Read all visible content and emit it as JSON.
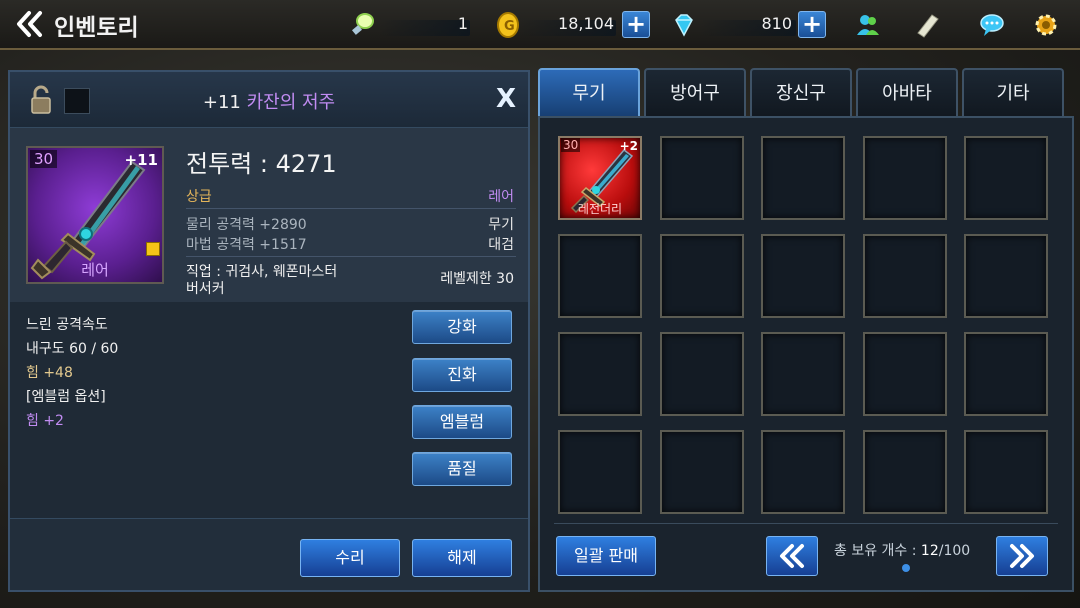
{
  "header": {
    "title": "인벤토리",
    "energy_value": "1",
    "gold_value": "18,104",
    "gem_value": "810",
    "plus_label": "+"
  },
  "item": {
    "enhance": "+11",
    "name": "카잔의 저주",
    "close_label": "X",
    "level": "30",
    "plus": "+11",
    "grade": "레어",
    "power_label": "전투력 : 4271",
    "quality": "상급",
    "rarity": "레어",
    "phys_attack": "물리 공격력 +2890",
    "magic_attack": "마법 공격력 +1517",
    "category": "무기",
    "weapon_type": "대검",
    "job_line1": "직업 : 귀검사, 웨폰마스터",
    "job_line2": "버서커",
    "level_limit": "레벨제한 30",
    "details": [
      "느린 공격속도",
      "내구도 60 / 60",
      "힘 +48",
      "[엠블럼 옵션]",
      "힘 +2"
    ]
  },
  "actions": {
    "reinforce": "강화",
    "evolve": "진화",
    "emblem": "엠블럼",
    "quality": "품질",
    "repair": "수리",
    "unequip": "해제"
  },
  "tabs": [
    "무기",
    "방어구",
    "장신구",
    "아바타",
    "기타"
  ],
  "grid": {
    "slot1_level": "30",
    "slot1_plus": "+2",
    "slot1_grade": "레전더리"
  },
  "footer": {
    "sell_all": "일괄 판매",
    "count_label": "총 보유 개수 : ",
    "count_current": "12",
    "count_total": "/100"
  },
  "colors": {
    "accent_blue": "#2f7fe0",
    "rare_purple": "#c18cf2",
    "legendary_red": "#d01313",
    "quality_gold": "#e3b45a"
  },
  "icons": {
    "back": "double-chevron-left-icon",
    "energy": "lightbulb-icon",
    "gold": "coin-icon",
    "gem": "diamond-icon",
    "friends": "friends-icon",
    "mail": "letter-icon",
    "chat": "chat-bubble-icon",
    "settings": "gear-icon",
    "lock": "padlock-icon"
  }
}
